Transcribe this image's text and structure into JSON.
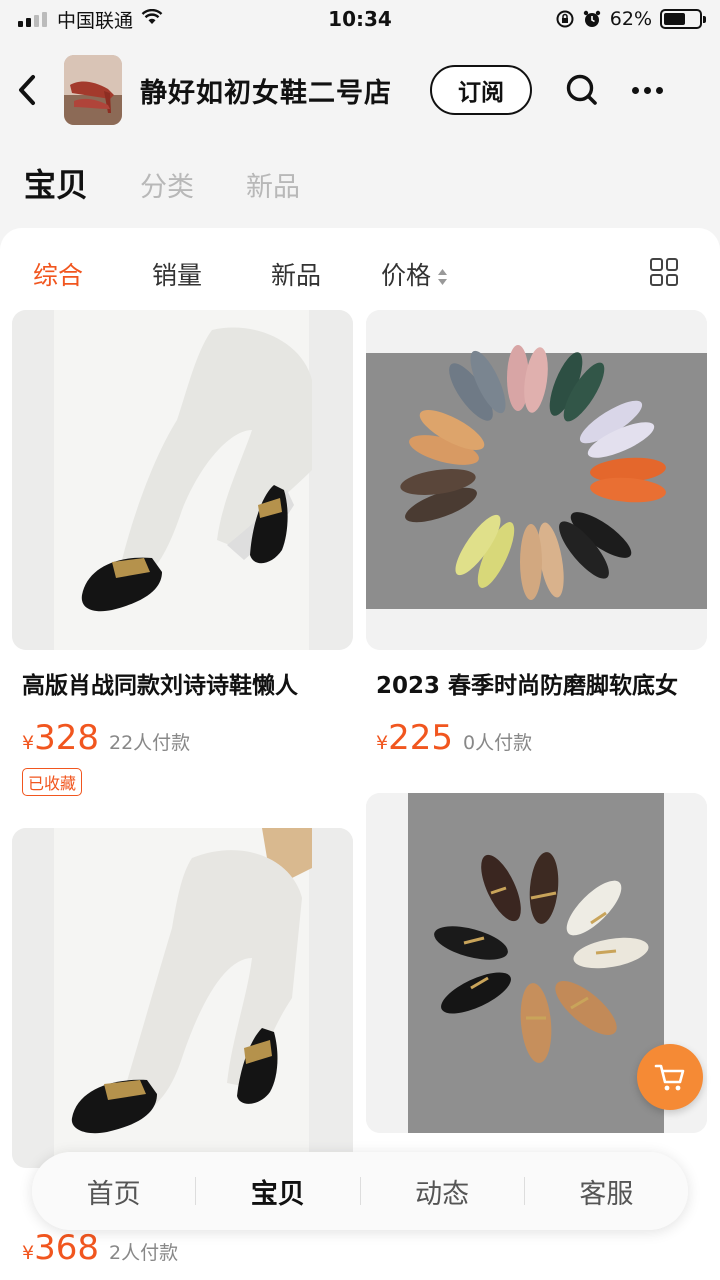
{
  "status_bar": {
    "carrier": "中国联通",
    "time": "10:34",
    "battery_text": "62%",
    "battery_level": 0.62
  },
  "header": {
    "shop_name": "静好如初女鞋二号店",
    "subscribe_label": "订阅"
  },
  "top_tabs": [
    {
      "label": "宝贝"
    },
    {
      "label": "分类"
    },
    {
      "label": "新品"
    }
  ],
  "sort_bar": {
    "items": [
      {
        "label": "综合"
      },
      {
        "label": "销量"
      },
      {
        "label": "新品"
      },
      {
        "label": "价格"
      }
    ]
  },
  "products": [
    {
      "title": "高版肖战同款刘诗诗鞋懒人",
      "currency": "¥",
      "price": "328",
      "sold": "22人付款",
      "badge": "已收藏"
    },
    {
      "title": "2023 春季时尚防磨脚软底女",
      "currency": "¥",
      "price": "225",
      "sold": "0人付款"
    },
    {
      "title": "",
      "currency": "¥",
      "price": "368",
      "sold": "2人付款"
    },
    {
      "title": ""
    }
  ],
  "bottom_nav": [
    {
      "label": "首页"
    },
    {
      "label": "宝贝"
    },
    {
      "label": "动态"
    },
    {
      "label": "客服"
    }
  ],
  "colors": {
    "accent": "#f1561f",
    "cart_button": "#f58a35"
  }
}
